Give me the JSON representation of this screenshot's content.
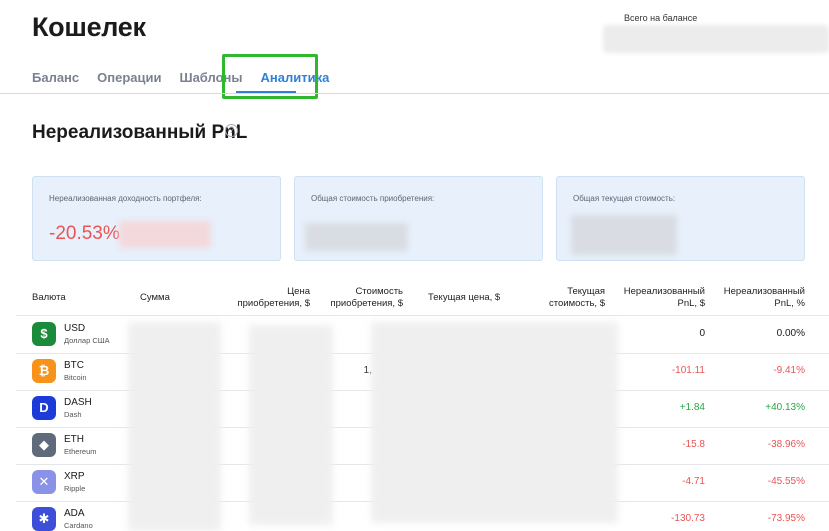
{
  "header": {
    "title": "Кошелек",
    "balance_label": "Всего на балансе"
  },
  "tabs": [
    {
      "label": "Баланс",
      "active": false
    },
    {
      "label": "Операции",
      "active": false
    },
    {
      "label": "Шаблоны",
      "active": false
    },
    {
      "label": "Аналитика",
      "active": true
    }
  ],
  "section": {
    "title": "Нереализованный PnL",
    "help_icon": "?"
  },
  "cards": [
    {
      "label": "Нереализованная доходность портфеля:",
      "value": "-20.53%"
    },
    {
      "label": "Общая стоимость приобретения:",
      "value": ""
    },
    {
      "label": "Общая текущая стоимость:",
      "value": ""
    }
  ],
  "table": {
    "headers": {
      "currency": "Валюта",
      "amount": "Сумма",
      "buy_price": "Цена приобретения, $",
      "buy_cost": "Стоимость приобретения, $",
      "cur_price": "Текущая цена, $",
      "cur_value": "Текущая стоимость, $",
      "pnl_usd": "Нереализованный PnL, $",
      "pnl_pct": "Нереализованный PnL, %"
    },
    "rows": [
      {
        "code": "USD",
        "name": "Доллар США",
        "icon": "dollar-icon",
        "icon_glyph": "$",
        "color": "#1b8a3a",
        "partial": "",
        "pnl_usd": "0",
        "pnl_pct": "0.00%",
        "sign": "neutral"
      },
      {
        "code": "BTC",
        "name": "Bitcoin",
        "icon": "bitcoin-icon",
        "icon_glyph": "₿",
        "color": "#f7931a",
        "partial": "1,",
        "pnl_usd": "-101.11",
        "pnl_pct": "-9.41%",
        "sign": "neg"
      },
      {
        "code": "DASH",
        "name": "Dash",
        "icon": "dash-icon",
        "icon_glyph": "D",
        "color": "#1c3bd9",
        "partial": "",
        "pnl_usd": "+1.84",
        "pnl_pct": "+40.13%",
        "sign": "pos"
      },
      {
        "code": "ETH",
        "name": "Ethereum",
        "icon": "ethereum-icon",
        "icon_glyph": "◆",
        "color": "#5f6b7a",
        "partial": "",
        "pnl_usd": "-15.8",
        "pnl_pct": "-38.96%",
        "sign": "neg"
      },
      {
        "code": "XRP",
        "name": "Ripple",
        "icon": "ripple-icon",
        "icon_glyph": "✕",
        "color": "#8a92e8",
        "partial": "",
        "pnl_usd": "-4.71",
        "pnl_pct": "-45.55%",
        "sign": "neg"
      },
      {
        "code": "ADA",
        "name": "Cardano",
        "icon": "cardano-icon",
        "icon_glyph": "✱",
        "color": "#3d4fd8",
        "partial": "",
        "pnl_usd": "-130.73",
        "pnl_pct": "-73.95%",
        "sign": "neg"
      }
    ]
  },
  "colors": {
    "accent": "#2f80d6",
    "negative": "#ea5455",
    "positive": "#28a745",
    "highlight": "#2fb82f",
    "card_bg": "#e7f0fb"
  }
}
